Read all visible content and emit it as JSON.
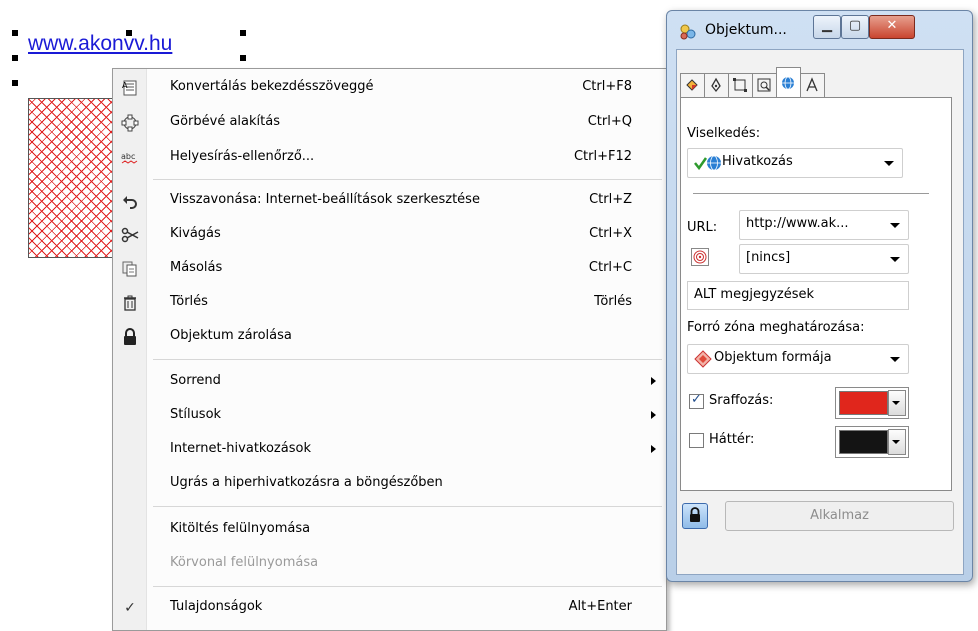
{
  "canvas": {
    "link_text": "www.akonvv.hu",
    "hatch_color": "#e02020"
  },
  "context_menu": {
    "items": [
      {
        "label": "Konvertálás bekezdésszöveggé",
        "shortcut": "Ctrl+F8",
        "icon": "paragraph-text-icon"
      },
      {
        "label": "Görbévé alakítás",
        "shortcut": "Ctrl+Q",
        "icon": "curve-icon"
      },
      {
        "label": "Helyesírás-ellenőrző...",
        "shortcut": "Ctrl+F12",
        "icon": "spellcheck-icon"
      },
      {
        "label": "Visszavonása: Internet-beállítások szerkesztése",
        "shortcut": "Ctrl+Z",
        "icon": "undo-icon"
      },
      {
        "label": "Kivágás",
        "shortcut": "Ctrl+X",
        "icon": "scissors-icon"
      },
      {
        "label": "Másolás",
        "shortcut": "Ctrl+C",
        "icon": "copy-icon"
      },
      {
        "label": "Törlés",
        "shortcut": "Törlés",
        "icon": "trash-icon"
      },
      {
        "label": "Objektum zárolása",
        "shortcut": "",
        "icon": "lock-icon"
      },
      {
        "label": "Sorrend",
        "submenu": true
      },
      {
        "label": "Stílusok",
        "submenu": true
      },
      {
        "label": "Internet-hivatkozások",
        "submenu": true
      },
      {
        "label": "Ugrás a hiperhivatkozásra a böngészőben"
      },
      {
        "label": "Kitöltés felülnyomása"
      },
      {
        "label": "Körvonal felülnyomása",
        "disabled": true
      },
      {
        "label": "Tulajdonságok",
        "shortcut": "Alt+Enter",
        "icon": "checkmark-icon"
      }
    ]
  },
  "properties_window": {
    "title": "Objektum...",
    "behavior_label": "Viselkedés:",
    "behavior_value": "Hivatkozás",
    "url_label": "URL:",
    "url_value": "http://www.ak...",
    "target_value": "[nincs]",
    "alt_placeholder": "ALT megjegyzések",
    "hotspot_label": "Forró zóna meghatározása:",
    "hotspot_value": "Objektum formája",
    "hatch_label": "Sraffozás:",
    "hatch_checked": true,
    "hatch_color": "#e0261c",
    "background_label": "Háttér:",
    "background_checked": false,
    "background_color": "#141414",
    "apply_label": "Alkalmaz"
  }
}
